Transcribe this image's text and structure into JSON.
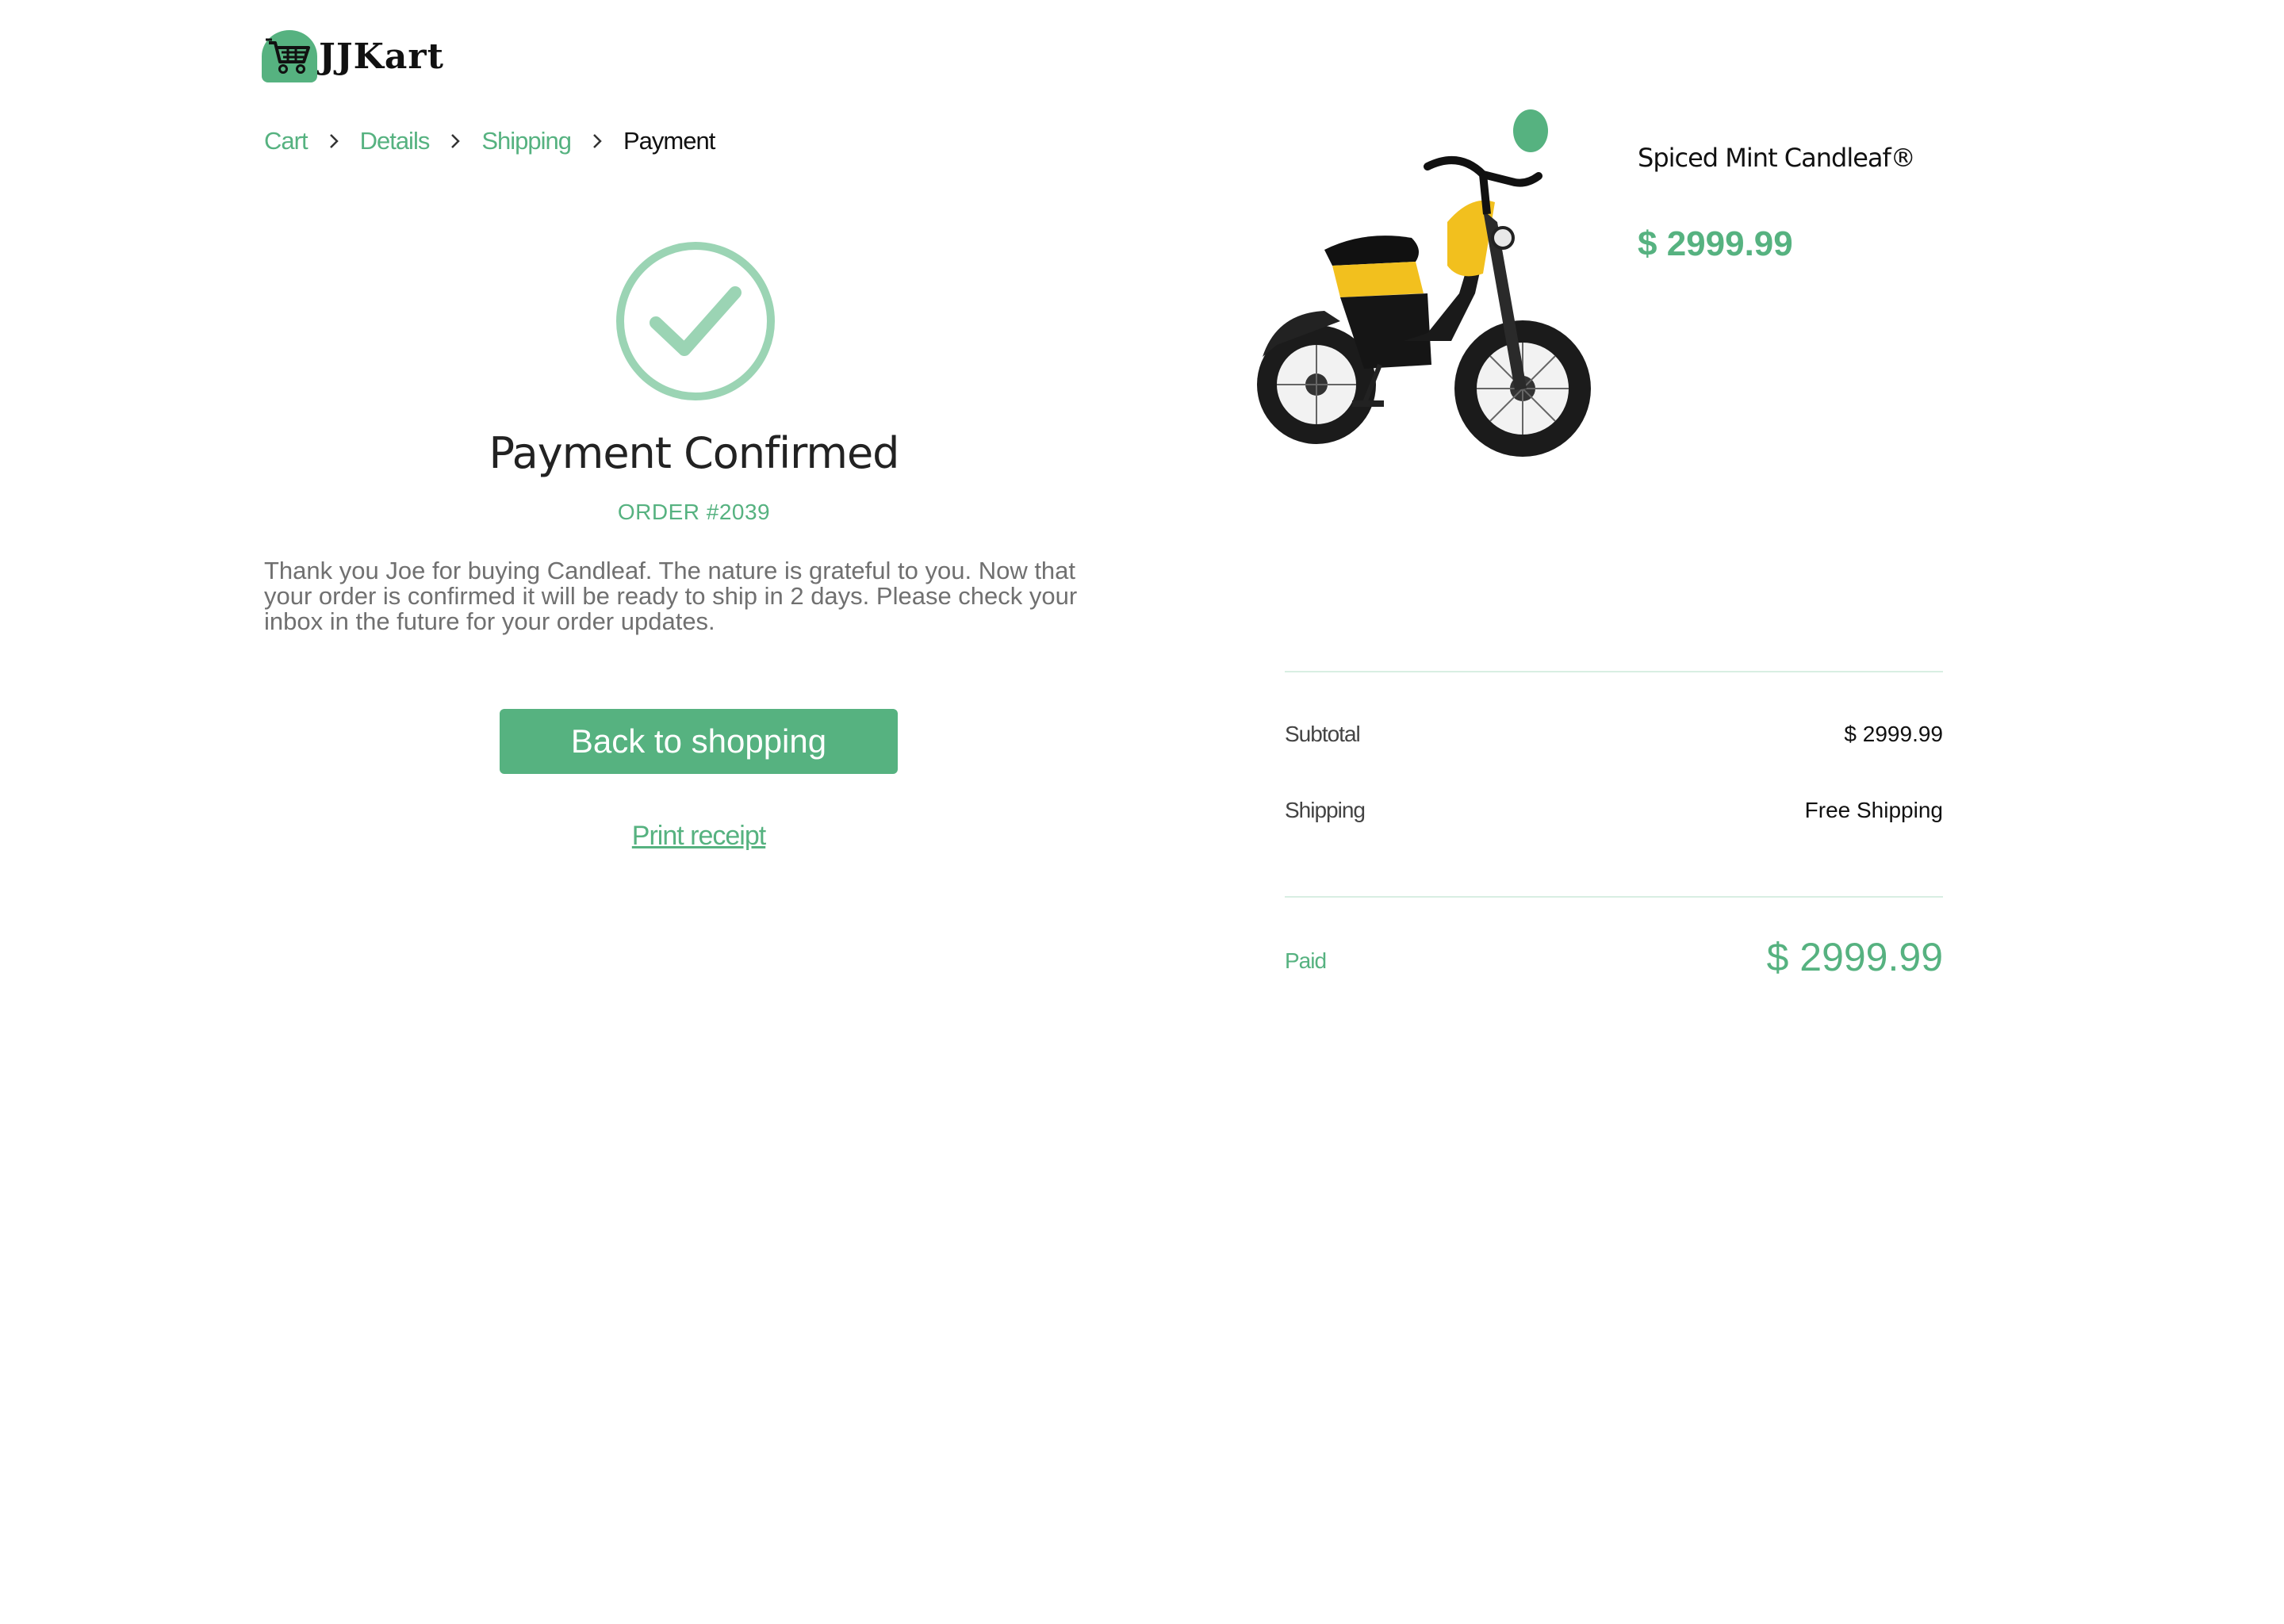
{
  "brand": {
    "name": "JJKart",
    "logo_icon": "shopping-cart-icon"
  },
  "breadcrumb": {
    "items": [
      {
        "label": "Cart"
      },
      {
        "label": "Details"
      },
      {
        "label": "Shipping"
      },
      {
        "label": "Payment"
      }
    ],
    "separator_icon": "chevron-right-icon"
  },
  "confirmation": {
    "icon": "check-circle-icon",
    "title": "Payment Confirmed",
    "order": "ORDER #2039",
    "message": " Thank you Joe for buying Candleaf. The nature is grateful to you. Now that your order is confirmed it will be ready to ship in 2 days. Please check your inbox in the future for your order updates.",
    "back_button": "Back to shopping",
    "print_link": "Print receipt"
  },
  "product": {
    "name": "Spiced Mint Candleaf®",
    "price": "$ 2999.99",
    "image": "electric-scooter-image"
  },
  "summary": {
    "subtotal_label": "Subtotal",
    "subtotal_value": "$ 2999.99",
    "shipping_label": "Shipping",
    "shipping_value": "Free Shipping",
    "paid_label": "Paid",
    "paid_value": "$ 2999.99"
  },
  "colors": {
    "accent": "#56b280",
    "check_ring": "#9bd4b4"
  }
}
